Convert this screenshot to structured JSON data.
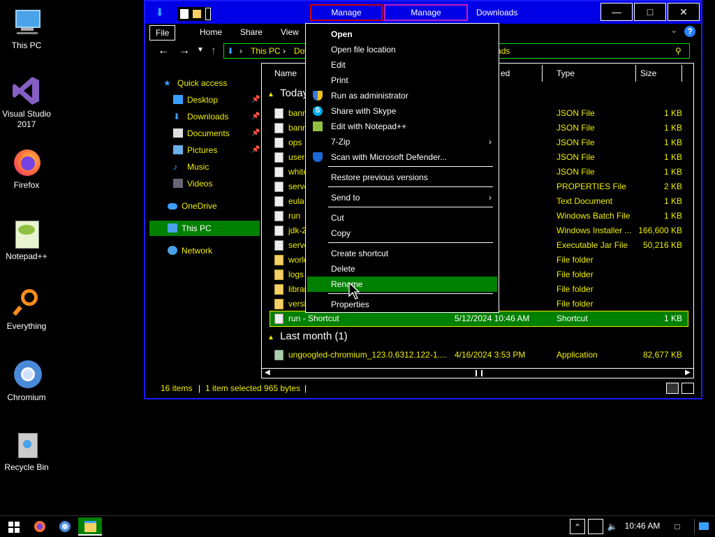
{
  "desktop": {
    "icons": [
      {
        "label": "This PC",
        "icon": "this-pc-icon"
      },
      {
        "label": "Visual Studio 2017",
        "icon": "visual-studio-icon"
      },
      {
        "label": "Firefox",
        "icon": "firefox-icon"
      },
      {
        "label": "Notepad++",
        "icon": "notepadpp-icon"
      },
      {
        "label": "Everything",
        "icon": "everything-icon"
      },
      {
        "label": "Chromium",
        "icon": "chromium-icon"
      },
      {
        "label": "Recycle Bin",
        "icon": "recycle-bin-icon"
      }
    ]
  },
  "window": {
    "title": "Downloads",
    "manage1": "Manage",
    "manage2": "Manage",
    "ribbon_tabs": [
      "File",
      "Home",
      "Share",
      "View"
    ],
    "path": [
      "This PC",
      "Dov"
    ],
    "search_fragment": "nloads",
    "nav": [
      {
        "label": "Quick access",
        "icon": "star-icon",
        "pinned": false
      },
      {
        "label": "Desktop",
        "icon": "desktop-folder-icon",
        "pinned": true
      },
      {
        "label": "Downloads",
        "icon": "downloads-folder-icon",
        "pinned": true
      },
      {
        "label": "Documents",
        "icon": "documents-folder-icon",
        "pinned": true
      },
      {
        "label": "Pictures",
        "icon": "pictures-folder-icon",
        "pinned": true
      },
      {
        "label": "Music",
        "icon": "music-folder-icon",
        "pinned": false
      },
      {
        "label": "Videos",
        "icon": "videos-folder-icon",
        "pinned": false
      },
      {
        "label": "OneDrive",
        "icon": "onedrive-icon",
        "pinned": false
      },
      {
        "label": "This PC",
        "icon": "this-pc-icon",
        "pinned": false
      },
      {
        "label": "Network",
        "icon": "network-icon",
        "pinned": false
      }
    ],
    "columns": {
      "name": "Name",
      "date": "ed",
      "type": "Type",
      "size": "Size"
    },
    "group_today": "Today",
    "group_last_month": "Last month (1)",
    "rows": [
      {
        "name": "bann",
        "date": "0:43 AM",
        "type": "JSON File",
        "size": "1 KB",
        "kind": "file"
      },
      {
        "name": "bann",
        "date": "0:43 AM",
        "type": "JSON File",
        "size": "1 KB",
        "kind": "file"
      },
      {
        "name": "ops",
        "date": "0:43 AM",
        "type": "JSON File",
        "size": "1 KB",
        "kind": "file"
      },
      {
        "name": "userc",
        "date": "0:43 AM",
        "type": "JSON File",
        "size": "1 KB",
        "kind": "file"
      },
      {
        "name": "white",
        "date": "0:43 AM",
        "type": "JSON File",
        "size": "1 KB",
        "kind": "file"
      },
      {
        "name": "serve",
        "date": "0:43 AM",
        "type": "PROPERTIES File",
        "size": "2 KB",
        "kind": "file"
      },
      {
        "name": "eula",
        "date": "0:43 AM",
        "type": "Text Document",
        "size": "1 KB",
        "kind": "file"
      },
      {
        "name": "run",
        "date": "0:45 AM",
        "type": "Windows Batch File",
        "size": "1 KB",
        "kind": "file"
      },
      {
        "name": "jdk-2",
        "date": "0:33 AM",
        "type": "Windows Installer ...",
        "size": "166,600 KB",
        "kind": "file"
      },
      {
        "name": "serve",
        "date": "0:32 AM",
        "type": "Executable Jar File",
        "size": "50,216 KB",
        "kind": "file"
      },
      {
        "name": "worlc",
        "date": "0:45 AM",
        "type": "File folder",
        "size": "",
        "kind": "folder"
      },
      {
        "name": "logs",
        "date": "0:43 AM",
        "type": "File folder",
        "size": "",
        "kind": "folder"
      },
      {
        "name": "librar",
        "date": "0:42 AM",
        "type": "File folder",
        "size": "",
        "kind": "folder"
      },
      {
        "name": "versic",
        "date": "0:42 AM",
        "type": "File folder",
        "size": "",
        "kind": "folder"
      },
      {
        "name": "run - Shortcut",
        "date": "5/12/2024 10:46 AM",
        "type": "Shortcut",
        "size": "1 KB",
        "kind": "file",
        "selected": true
      }
    ],
    "last_month_row": {
      "name": "ungoogled-chromium_123.0.6312.122-1....",
      "date": "4/16/2024 3:53 PM",
      "type": "Application",
      "size": "82,677 KB"
    },
    "status": {
      "items": "16 items",
      "selected": "1 item selected  965 bytes"
    }
  },
  "context_menu": {
    "items": [
      {
        "label": "Open",
        "bold": true
      },
      {
        "label": "Open file location"
      },
      {
        "label": "Edit"
      },
      {
        "label": "Print"
      },
      {
        "label": "Run as administrator",
        "icon": "shield-icon"
      },
      {
        "label": "Share with Skype",
        "icon": "skype-icon"
      },
      {
        "label": "Edit with Notepad++",
        "icon": "notepadpp-icon"
      },
      {
        "label": "7-Zip",
        "submenu": true
      },
      {
        "label": "Scan with Microsoft Defender...",
        "icon": "defender-icon"
      },
      {
        "label": "Restore previous versions"
      },
      {
        "label": "Send to",
        "submenu": true
      },
      {
        "label": "Cut"
      },
      {
        "label": "Copy"
      },
      {
        "label": "Create shortcut"
      },
      {
        "label": "Delete"
      },
      {
        "label": "Rename",
        "highlighted": true
      },
      {
        "label": "Properties"
      }
    ]
  },
  "taskbar": {
    "clock": "10:46 AM"
  }
}
